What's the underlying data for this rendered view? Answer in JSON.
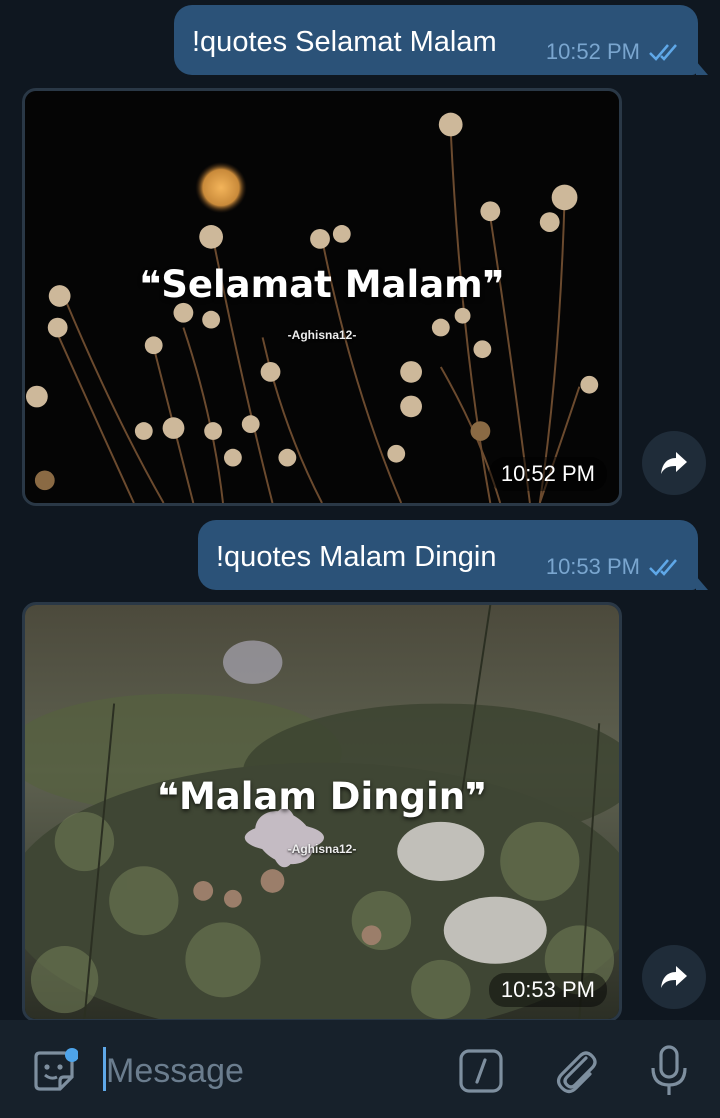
{
  "messages": [
    {
      "type": "outgoing",
      "text": "!quotes Selamat Malam",
      "time": "10:52 PM",
      "status": "read"
    },
    {
      "type": "photo",
      "quote_open": "❝",
      "quote_text": "Selamat Malam",
      "quote_close": "❞",
      "author": "-Aghisna12-",
      "time": "10:52 PM",
      "scene": "night-flowers"
    },
    {
      "type": "outgoing",
      "text": "!quotes Malam Dingin",
      "time": "10:53 PM",
      "status": "read"
    },
    {
      "type": "photo",
      "quote_open": "❝",
      "quote_text": "Malam Dingin",
      "quote_close": "❞",
      "author": "-Aghisna12-",
      "time": "10:53 PM",
      "scene": "moss-flowers"
    }
  ],
  "composer": {
    "placeholder": "Message",
    "icons": [
      "sticker-icon",
      "bot-command-icon",
      "attach-icon",
      "microphone-icon"
    ]
  },
  "colors": {
    "background": "#0f1720",
    "outgoing_bubble": "#2b5278",
    "composer": "#17212b",
    "accent": "#5fa8e8"
  }
}
